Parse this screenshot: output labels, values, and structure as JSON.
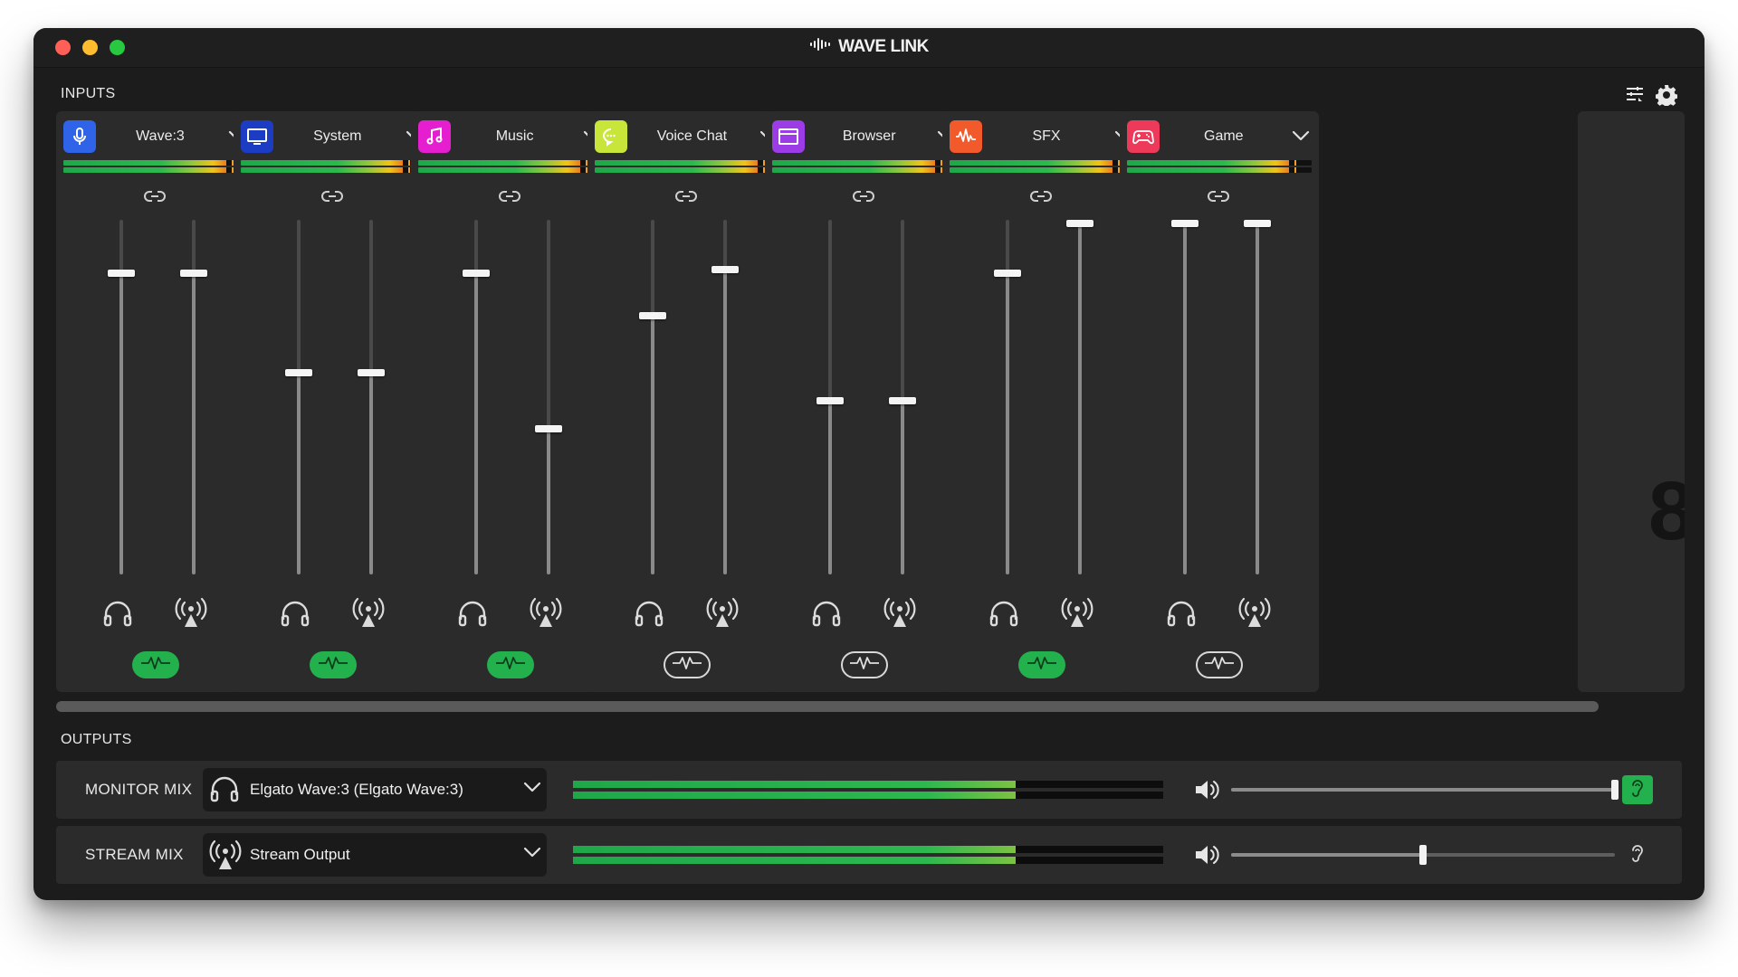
{
  "app": {
    "title": "WAVE LINK"
  },
  "inputs": {
    "label": "INPUTS",
    "channels": [
      {
        "name": "Wave:3",
        "icon": "microphone-icon",
        "color": "#2f63e8",
        "monitor_level": 0.85,
        "stream_level": 0.85,
        "meter": 0.88,
        "fx_on": true
      },
      {
        "name": "System",
        "icon": "monitor-icon",
        "color": "#1c3cc4",
        "monitor_level": 0.57,
        "stream_level": 0.57,
        "meter": 0.88,
        "fx_on": true
      },
      {
        "name": "Music",
        "icon": "music-note-icon",
        "color": "#e51fd0",
        "monitor_level": 0.85,
        "stream_level": 0.41,
        "meter": 0.88,
        "fx_on": true
      },
      {
        "name": "Voice Chat",
        "icon": "chat-bubble-icon",
        "color": "#c8e63a",
        "monitor_level": 0.73,
        "stream_level": 0.86,
        "meter": 0.88,
        "fx_on": false
      },
      {
        "name": "Browser",
        "icon": "browser-window-icon",
        "color": "#9b3ce6",
        "monitor_level": 0.49,
        "stream_level": 0.49,
        "meter": 0.88,
        "fx_on": false
      },
      {
        "name": "SFX",
        "icon": "waveform-icon",
        "color": "#f25a2c",
        "monitor_level": 0.85,
        "stream_level": 0.99,
        "meter": 0.88,
        "fx_on": true
      },
      {
        "name": "Game",
        "icon": "gamepad-icon",
        "color": "#ee3a5a",
        "monitor_level": 0.99,
        "stream_level": 0.99,
        "meter": 0.88,
        "fx_on": false
      }
    ],
    "partial_next_channel_text": "8"
  },
  "outputs": {
    "label": "OUTPUTS",
    "rows": [
      {
        "label": "MONITOR MIX",
        "device": "Elgato Wave:3 (Elgato Wave:3)",
        "icon": "headphones-icon",
        "meter": 0.75,
        "volume": 1.0,
        "listen_on": true
      },
      {
        "label": "STREAM MIX",
        "device": "Stream Output",
        "icon": "broadcast-icon",
        "meter": 0.75,
        "volume": 0.5,
        "listen_on": false
      }
    ]
  },
  "colors": {
    "accent_green": "#23b14d",
    "panel": "#2b2b2b",
    "background": "#1c1c1c"
  }
}
